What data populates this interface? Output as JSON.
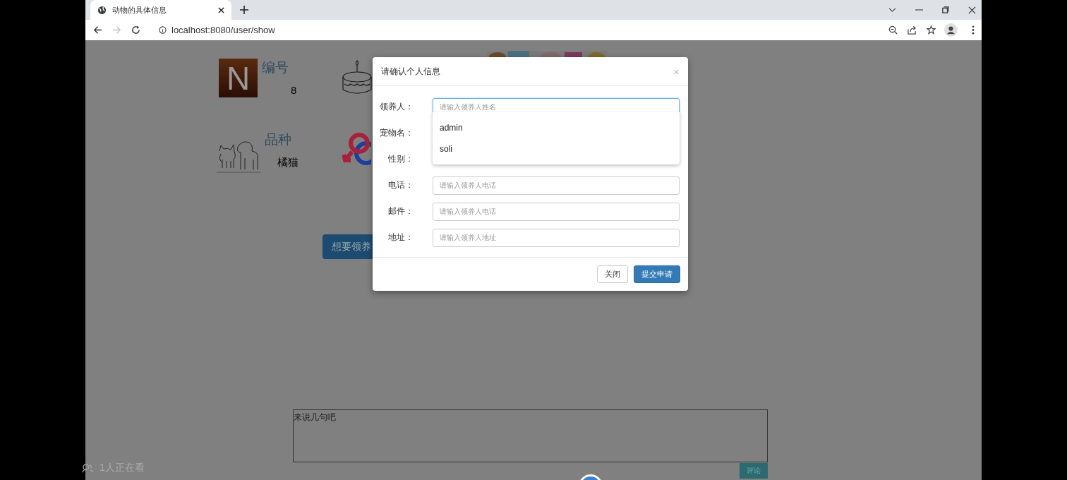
{
  "browser": {
    "tab": {
      "title": "动物的具体信息",
      "selected": true
    },
    "url": "localhost:8080/user/show",
    "forward_disabled": true
  },
  "page": {
    "info": [
      {
        "kind": "number",
        "badge": "N",
        "label": "编号",
        "value": "8"
      },
      {
        "kind": "breed",
        "label": "品种",
        "value": "橘猫"
      }
    ],
    "adopt_button": "想要领养",
    "comment": {
      "placeholder": "来说几句吧",
      "button": "评论"
    }
  },
  "modal": {
    "title": "请确认个人信息",
    "close": "×",
    "fields": [
      {
        "label": "领养人：",
        "placeholder": "请输入领养人姓名",
        "focused": true
      },
      {
        "label": "宠物名："
      },
      {
        "label": "性别："
      },
      {
        "label": "电话：",
        "placeholder": "请输入领养人电话",
        "focused": false
      },
      {
        "label": "邮件：",
        "placeholder": "请输入领养人电话",
        "focused": false
      },
      {
        "label": "地址：",
        "placeholder": "请输入领养人地址",
        "focused": false
      }
    ],
    "suggestions": [
      {
        "text": "admin",
        "selected": false
      },
      {
        "text": "soli",
        "selected": false
      }
    ],
    "buttons": [
      {
        "kind": "secondary",
        "label": "关闭"
      },
      {
        "kind": "primary",
        "label": "提交申请"
      }
    ]
  },
  "viewers": "1人正在看"
}
